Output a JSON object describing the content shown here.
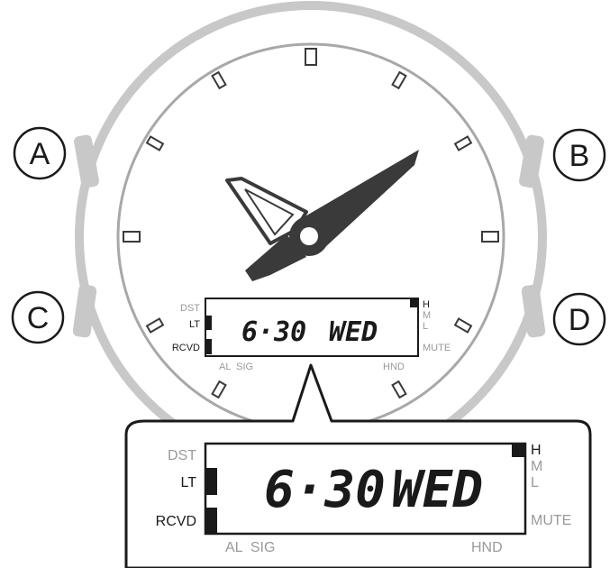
{
  "buttons": {
    "a": "A",
    "b": "B",
    "c": "C",
    "d": "D"
  },
  "lcd": {
    "indicators_left": {
      "dst": "DST",
      "lt": "LT",
      "rcvd": "RCVD"
    },
    "indicators_right": {
      "h": "H",
      "m": "M",
      "l": "L",
      "mute": "MUTE"
    },
    "bottom": {
      "al_sig": "AL  SIG",
      "hnd": "HND"
    },
    "time": "6·30",
    "day": "WED"
  },
  "colors": {
    "bezel": "#c8c8c8",
    "dial_ring": "#a8a8a8",
    "hands": "#3a3a3a",
    "dim_label": "#9a9a9a",
    "text_dark": "#1a1a1a"
  },
  "icons": {
    "hands": "analog-hands-icon",
    "index": "hour-marker-icon"
  }
}
